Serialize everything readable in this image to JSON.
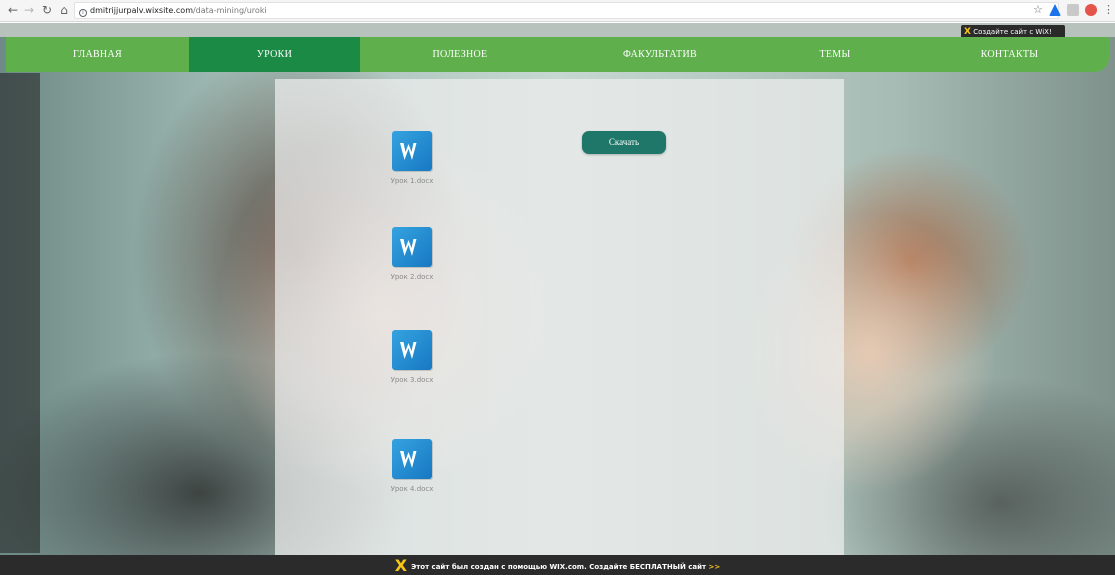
{
  "browser": {
    "url_host": "dmitrijjurpalv.wixsite.com",
    "url_path": "/data-mining/uroki"
  },
  "wix_badge": "Создайте сайт с WiX!",
  "nav": {
    "items": [
      {
        "label": "ГЛАВНАЯ"
      },
      {
        "label": "УРОКИ"
      },
      {
        "label": "ПОЛЕЗНОЕ"
      },
      {
        "label": "ФАКУЛЬТАТИВ"
      },
      {
        "label": "ТЕМЫ"
      },
      {
        "label": "КОНТАКТЫ"
      }
    ],
    "active_index": 1
  },
  "documents": [
    {
      "name": "Урок 1.docx",
      "icon": "word-icon"
    },
    {
      "name": "Урок 2.docx",
      "icon": "word-icon"
    },
    {
      "name": "Урок 3.docx",
      "icon": "word-icon"
    },
    {
      "name": "Урок 4.docx",
      "icon": "word-icon"
    }
  ],
  "download_button": "Скачать",
  "footer": {
    "text": "Этот сайт был создан с помощью WIX.com. Создайте БЕСПЛАТНЫЙ сайт",
    "arrows": ">>"
  },
  "colors": {
    "nav_bg": "#5fb04d",
    "nav_active": "#1b8a45",
    "button_bg": "#1f7769",
    "footer_bg": "#2b2b2b",
    "wix_yellow": "#f5c518"
  }
}
